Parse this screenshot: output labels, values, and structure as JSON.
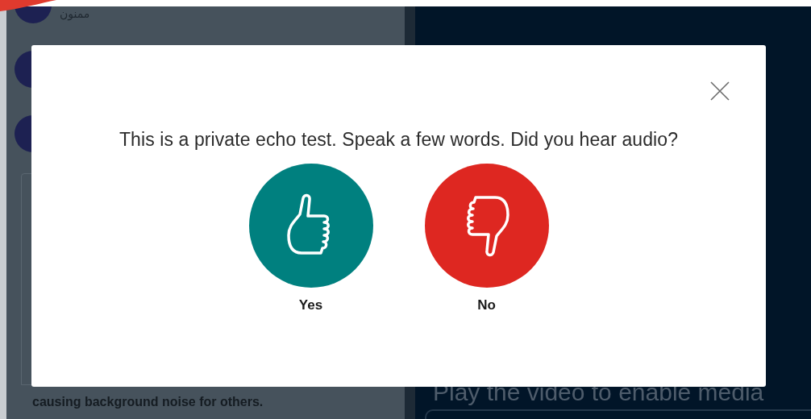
{
  "contacts": [
    {
      "kind": "message",
      "text": "ممنون"
    },
    {
      "kind": "avatar"
    },
    {
      "kind": "avatar"
    }
  ],
  "notice": "causing background noise for others.",
  "video_hint": "Play the video to enable media",
  "modal": {
    "message": "This is a private echo test. Speak a few words. Did you hear audio?",
    "buttons": [
      {
        "kind": "yes",
        "label": "Yes"
      },
      {
        "kind": "no",
        "label": "No"
      }
    ]
  }
}
